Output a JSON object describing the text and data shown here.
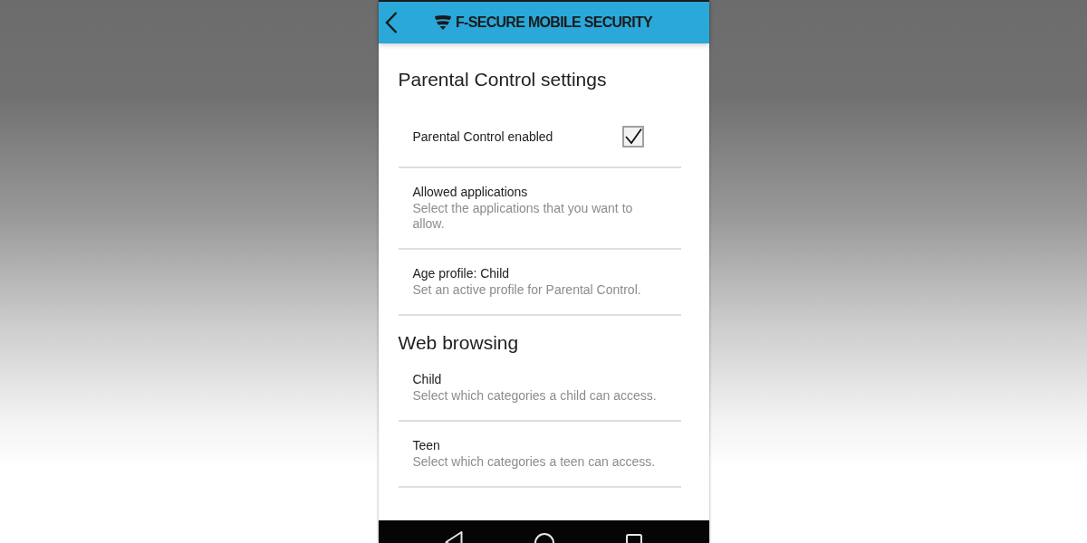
{
  "app_bar": {
    "title": "F-SECURE MOBILE SECURITY"
  },
  "sections": [
    {
      "title": "Parental Control settings",
      "items": [
        {
          "kind": "checkbox",
          "title": "Parental Control enabled",
          "checked": true
        },
        {
          "kind": "link",
          "title": "Allowed applications",
          "description": "Select the applications that you want to allow."
        },
        {
          "kind": "link",
          "title": "Age profile: Child",
          "description": "Set an active profile for Parental Control."
        }
      ]
    },
    {
      "title": "Web browsing",
      "items": [
        {
          "kind": "link",
          "title": "Child",
          "description": "Select which categories a child can access."
        },
        {
          "kind": "link",
          "title": "Teen",
          "description": "Select which categories a teen can access."
        }
      ]
    }
  ]
}
